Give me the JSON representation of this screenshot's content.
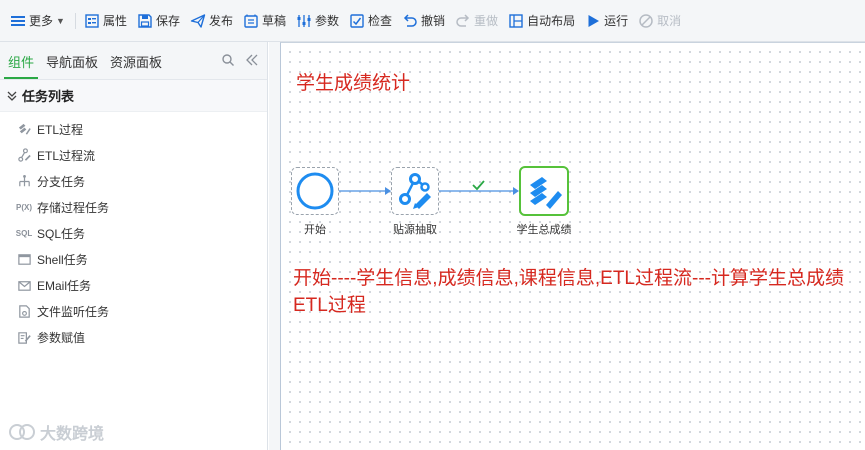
{
  "toolbar": {
    "more": "更多",
    "properties": "属性",
    "save": "保存",
    "publish": "发布",
    "draft": "草稿",
    "params": "参数",
    "check": "检查",
    "undo": "撤销",
    "redo": "重做",
    "auto_layout": "自动布局",
    "run": "运行",
    "cancel": "取消"
  },
  "left_panel": {
    "tabs": [
      "组件",
      "导航面板",
      "资源面板"
    ],
    "section_title": "任务列表",
    "items": [
      {
        "label": "ETL过程",
        "icon": "etl-process-icon"
      },
      {
        "label": "ETL过程流",
        "icon": "etl-flow-icon"
      },
      {
        "label": "分支任务",
        "icon": "branch-icon"
      },
      {
        "label": "存储过程任务",
        "icon": "stored-procedure-icon",
        "badge": "P(X)"
      },
      {
        "label": "SQL任务",
        "icon": "sql-icon",
        "badge": "SQL"
      },
      {
        "label": "Shell任务",
        "icon": "shell-icon"
      },
      {
        "label": "EMail任务",
        "icon": "email-icon"
      },
      {
        "label": "文件监听任务",
        "icon": "file-watch-icon"
      },
      {
        "label": "参数赋值",
        "icon": "param-assign-icon"
      }
    ]
  },
  "canvas": {
    "title": "学生成绩统计",
    "nodes": [
      {
        "label": "开始",
        "icon": "start-circle-icon"
      },
      {
        "label": "贴源抽取",
        "icon": "etl-flow-icon"
      },
      {
        "label": "学生总成绩",
        "icon": "etl-process-icon",
        "selected": true
      }
    ],
    "note": "开始----学生信息,成绩信息,课程信息,ETL过程流---计算学生总成绩ETL过程"
  },
  "watermark": "大数跨境",
  "colors": {
    "accent_green": "#2aa845",
    "annotation_red": "#d6281f",
    "node_blue": "#1e8cf0",
    "selected_border": "#56c23a"
  }
}
